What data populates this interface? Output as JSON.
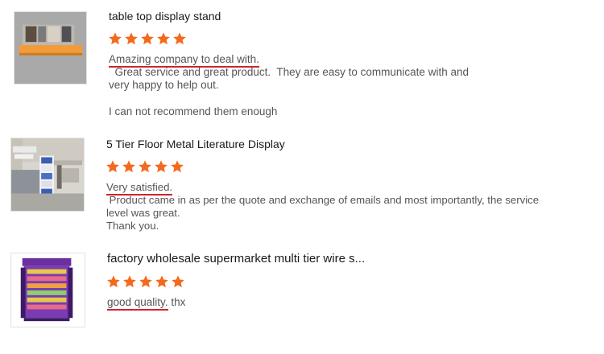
{
  "accent": "#f36a1e",
  "underline_color": "#d0232b",
  "reviews": [
    {
      "title": "table top display stand",
      "rating": 5,
      "highlight": "Amazing company to deal with.",
      "rest": "  Great service and great product.  They are easy to communicate with and",
      "line2": "very happy to help out.",
      "line3": "I can not recommend them enough",
      "image": "orange-display-stand-photo"
    },
    {
      "title": "5 Tier Floor Metal Literature Display",
      "rating": 5,
      "highlight": "Very satisfied.",
      "rest": " Product came in as per the quote and exchange of emails and most importantly, the service",
      "line2": "level was great.",
      "line3": "Thank you.",
      "image": "office-literature-rack-photo"
    },
    {
      "title": "factory wholesale supermarket multi tier wire s...",
      "rating": 5,
      "highlight": "good quality.",
      "rest": " thx",
      "image": "purple-wire-rack-photo"
    }
  ]
}
